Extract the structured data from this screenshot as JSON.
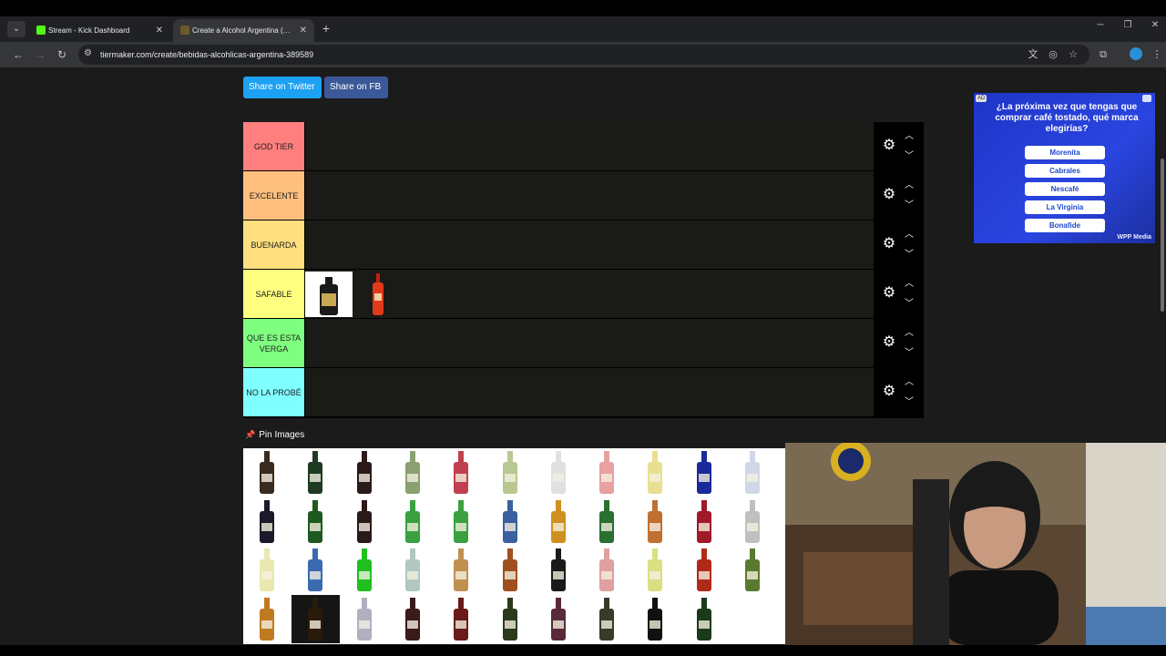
{
  "browser": {
    "tabs": [
      {
        "title": "Stream - Kick Dashboard",
        "favicon_color": "#53fc18",
        "active": false
      },
      {
        "title": "Create a Alcohol Argentina (Esc",
        "favicon_color": "#6b5a2a",
        "active": true
      }
    ],
    "new_tab": "+",
    "url": "tiermaker.com/create/bebidas-alcohlicas-argentina-389589",
    "window_controls": [
      "─",
      "❐",
      "✕"
    ]
  },
  "page": {
    "share_twitter": "Share on Twitter",
    "share_fb": "Share on FB",
    "pin_images": "Pin Images",
    "tiers": [
      {
        "label": "GOD TIER",
        "color": "#ff7f7f",
        "items": []
      },
      {
        "label": "EXCELENTE",
        "color": "#ffbf7f",
        "items": []
      },
      {
        "label": "BUENARDA",
        "color": "#ffdf7f",
        "items": []
      },
      {
        "label": "SAFABLE",
        "color": "#ffff7f",
        "items": [
          "dark-bottle-label",
          "red-aperitif-bottle"
        ]
      },
      {
        "label": "QUE ES ESTA VERGA",
        "color": "#7fff7f",
        "items": []
      },
      {
        "label": "NO LA PROBÉ",
        "color": "#7fffff",
        "items": []
      }
    ],
    "pool_rows": [
      [
        "#3a2b1e",
        "#1e3a22",
        "#2a1a1a",
        "#8aa070",
        "#c04050",
        "#b8c890",
        "#e0e0e0",
        "#e8a0a0",
        "#e8e090",
        "#1a2a9a",
        "#d0d8e8"
      ],
      [
        "#1a1a2a",
        "#1e5a1e",
        "#2a1a1a",
        "#3aa040",
        "#3aa040",
        "#3a60a0",
        "#d09020",
        "#2a7030",
        "#c07030",
        "#a01a2a",
        "#c0c0c0"
      ],
      [
        "#e8e8b0",
        "#3a6ab0",
        "#20c020",
        "#b0c8c0",
        "#c09050",
        "#a05020",
        "#1a1a1a",
        "#e0a0a0",
        "#d8e080",
        "#b02a1a",
        "#5a7a30"
      ],
      [
        "#c07a20",
        "#2a1a0a",
        "#b0b0c0",
        "#3a1a1a",
        "#6a1a1a",
        "#2a3a1a",
        "#5a2a3a",
        "#3a3a2a",
        "#111111",
        "#1a3a1a"
      ]
    ]
  },
  "ad": {
    "badge": "AD",
    "question": "¿La próxima vez que tengas que comprar café tostado, qué marca elegirías?",
    "options": [
      "Morenita",
      "Cabrales",
      "Nescafé",
      "La Virginia",
      "Bonafide"
    ],
    "brand": "WPP Media"
  }
}
